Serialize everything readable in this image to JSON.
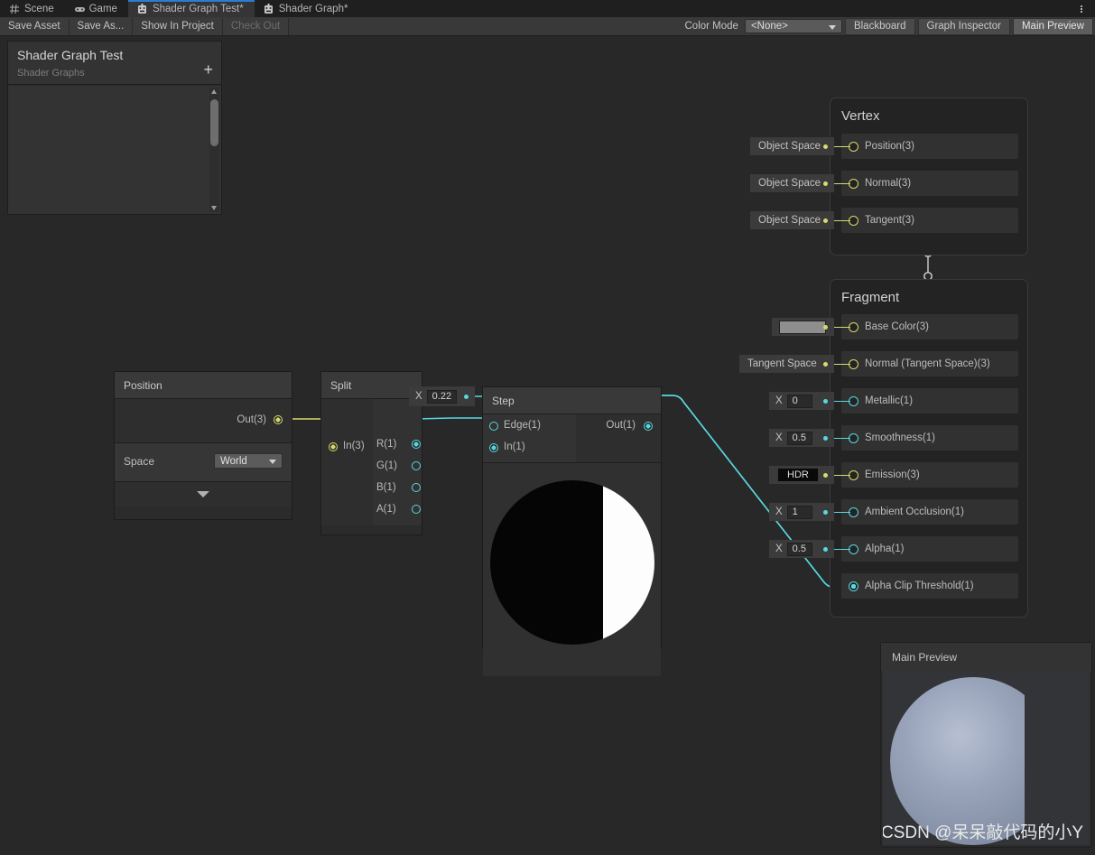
{
  "window": {
    "tabs": [
      {
        "label": "Scene",
        "icon": "grid-icon",
        "state": "inactive"
      },
      {
        "label": "Game",
        "icon": "gamepad-icon",
        "state": "inactive"
      },
      {
        "label": "Shader Graph Test*",
        "icon": "shadergraph-icon",
        "state": "active"
      },
      {
        "label": "Shader Graph*",
        "icon": "shadergraph-icon",
        "state": "inactive"
      }
    ],
    "kebab_icon": "more-options-icon"
  },
  "toolbar": {
    "save_asset": "Save Asset",
    "save_as": "Save As...",
    "show_in_project": "Show In Project",
    "check_out": "Check Out",
    "color_mode_label": "Color Mode",
    "color_mode_value": "<None>",
    "blackboard": "Blackboard",
    "graph_inspector": "Graph Inspector",
    "main_preview": "Main Preview"
  },
  "blackboard": {
    "title": "Shader Graph Test",
    "subtitle": "Shader Graphs",
    "add_icon": "plus-icon",
    "scroll_up_icon": "caret-up-icon",
    "scroll_down_icon": "caret-down-icon"
  },
  "nodes": {
    "position": {
      "title": "Position",
      "out_label": "Out(3)",
      "space_label": "Space",
      "space_value": "World",
      "expand_icon": "chevron-down-icon"
    },
    "split": {
      "title": "Split",
      "in_label": "In(3)",
      "outputs": [
        "R(1)",
        "G(1)",
        "B(1)",
        "A(1)"
      ]
    },
    "step": {
      "title": "Step",
      "edge_label": "Edge(1)",
      "in_label": "In(1)",
      "out_label": "Out(1)",
      "edge_axis": "X",
      "edge_value": "0.22",
      "preview_icon": "step-preview-sphere"
    }
  },
  "vertex": {
    "title": "Vertex",
    "slots": [
      {
        "label": "Position(3)",
        "chip_type": "space",
        "chip_value": "Object Space",
        "dot": "yellow"
      },
      {
        "label": "Normal(3)",
        "chip_type": "space",
        "chip_value": "Object Space",
        "dot": "yellow"
      },
      {
        "label": "Tangent(3)",
        "chip_type": "space",
        "chip_value": "Object Space",
        "dot": "yellow"
      }
    ]
  },
  "fragment": {
    "title": "Fragment",
    "slots": [
      {
        "label": "Base Color(3)",
        "chip_type": "color",
        "chip_value": "",
        "swatch_color": "#8e8e8e",
        "dot": "yellow"
      },
      {
        "label": "Normal (Tangent Space)(3)",
        "chip_type": "space",
        "chip_value": "Tangent Space",
        "dot": "yellow"
      },
      {
        "label": "Metallic(1)",
        "chip_type": "float",
        "chip_axis": "X",
        "chip_value": "0",
        "dot": "cyan"
      },
      {
        "label": "Smoothness(1)",
        "chip_type": "float",
        "chip_axis": "X",
        "chip_value": "0.5",
        "dot": "cyan"
      },
      {
        "label": "Emission(3)",
        "chip_type": "hdr",
        "chip_value": "HDR",
        "dot": "yellow"
      },
      {
        "label": "Ambient Occlusion(1)",
        "chip_type": "float",
        "chip_axis": "X",
        "chip_value": "1",
        "dot": "cyan"
      },
      {
        "label": "Alpha(1)",
        "chip_type": "float",
        "chip_axis": "X",
        "chip_value": "0.5",
        "dot": "cyan"
      },
      {
        "label": "Alpha Clip Threshold(1)",
        "chip_type": "connected",
        "chip_value": "",
        "dot": "cyan-filled"
      }
    ]
  },
  "main_preview": {
    "title": "Main Preview",
    "watermark": "CSDN @呆呆敲代码的小Y"
  },
  "colors": {
    "wire_float": "#58d8e0",
    "wire_vector": "#d8da6e",
    "accent_tab": "#2b7cd4",
    "canvas_bg": "#282828"
  }
}
